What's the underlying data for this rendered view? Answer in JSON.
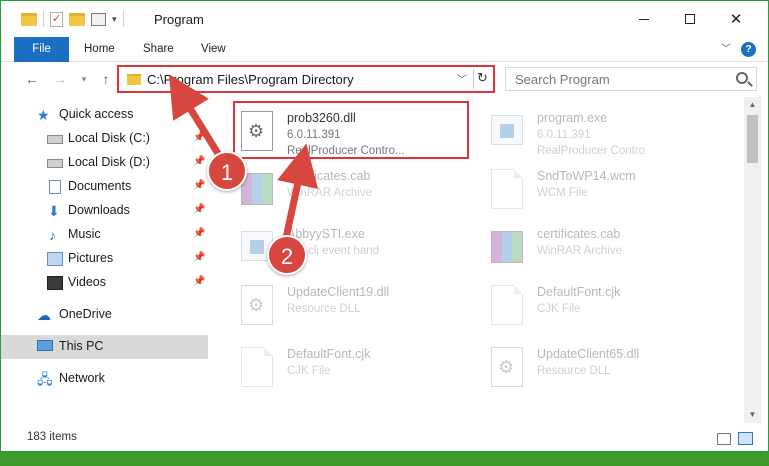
{
  "window": {
    "title": "Program",
    "tabs": [
      "File",
      "Home",
      "Share",
      "View"
    ]
  },
  "address": {
    "path": "C:\\Program Files\\Program Directory",
    "search_placeholder": "Search Program"
  },
  "sidebar": {
    "items": [
      {
        "label": "Quick access",
        "icon": "star-icon"
      },
      {
        "label": "Local Disk (C:)",
        "icon": "drive-icon",
        "pinned": true
      },
      {
        "label": "Local Disk (D:)",
        "icon": "drive-icon",
        "pinned": true
      },
      {
        "label": "Documents",
        "icon": "documents-icon",
        "pinned": true
      },
      {
        "label": "Downloads",
        "icon": "download-icon",
        "pinned": true
      },
      {
        "label": "Music",
        "icon": "music-icon",
        "pinned": true
      },
      {
        "label": "Pictures",
        "icon": "pictures-icon",
        "pinned": true
      },
      {
        "label": "Videos",
        "icon": "videos-icon",
        "pinned": true
      },
      {
        "label": "OneDrive",
        "icon": "cloud-icon"
      },
      {
        "label": "This PC",
        "icon": "computer-icon",
        "selected": true
      },
      {
        "label": "Network",
        "icon": "network-icon"
      }
    ]
  },
  "files": [
    {
      "name": "prob3260.dll",
      "meta1": "6.0.11.391",
      "meta2": "RealProducer Contro...",
      "icon": "dll-icon",
      "highlighted": true
    },
    {
      "name": "program.exe",
      "meta1": "6.0.11.391",
      "meta2": "RealProducer Contro",
      "icon": "exe-icon"
    },
    {
      "name": "certificates.cab",
      "meta1": "WinRAR Archive",
      "meta2": "",
      "icon": "rar-icon"
    },
    {
      "name": "SndToWP14.wcm",
      "meta1": "WCM File",
      "meta2": "",
      "icon": "page-icon"
    },
    {
      "name": "AbbyySTI.exe",
      "meta1": "STI cli event hand",
      "meta2": "",
      "icon": "exe-icon"
    },
    {
      "name": "certificates.cab",
      "meta1": "WinRAR Archive",
      "meta2": "",
      "icon": "rar-icon"
    },
    {
      "name": "UpdateClient19.dll",
      "meta1": "Resource DLL",
      "meta2": "",
      "icon": "dll-icon"
    },
    {
      "name": "DefaultFont.cjk",
      "meta1": "CJK File",
      "meta2": "",
      "icon": "page-icon"
    },
    {
      "name": "DefaultFont.cjk",
      "meta1": "CJK File",
      "meta2": "",
      "icon": "page-icon"
    },
    {
      "name": "UpdateClient65.dll",
      "meta1": "Resource DLL",
      "meta2": "",
      "icon": "dll-icon"
    }
  ],
  "status": {
    "item_count": "183 items"
  },
  "annotations": {
    "step1": "1",
    "step2": "2",
    "color": "#d8473f"
  },
  "colors": {
    "accent": "#1a6fc2",
    "highlight_border": "#e0343a"
  }
}
